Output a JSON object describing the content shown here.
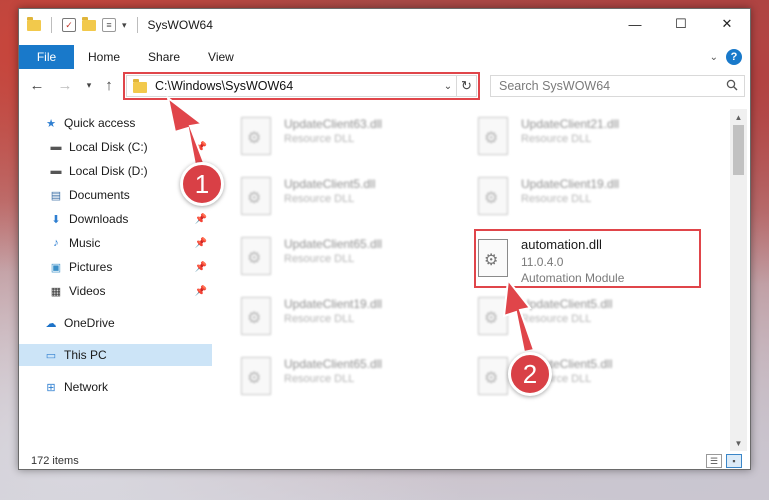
{
  "window": {
    "title": "SysWOW64",
    "controls": {
      "minimize": "—",
      "maximize": "☐",
      "close": "✕"
    }
  },
  "ribbon": {
    "tabs": [
      "File",
      "Home",
      "Share",
      "View"
    ],
    "help": "?"
  },
  "address": {
    "path": "C:\\Windows\\SysWOW64",
    "search_placeholder": "Search SysWOW64"
  },
  "nav": {
    "items": [
      {
        "label": "Quick access",
        "icon": "star-icon",
        "pinned": false
      },
      {
        "label": "Local Disk (C:)",
        "icon": "drive-icon",
        "pinned": true
      },
      {
        "label": "Local Disk (D:)",
        "icon": "drive-icon",
        "pinned": false
      },
      {
        "label": "Documents",
        "icon": "document-icon",
        "pinned": false
      },
      {
        "label": "Downloads",
        "icon": "download-icon",
        "pinned": true
      },
      {
        "label": "Music",
        "icon": "music-icon",
        "pinned": true
      },
      {
        "label": "Pictures",
        "icon": "pictures-icon",
        "pinned": true
      },
      {
        "label": "Videos",
        "icon": "video-icon",
        "pinned": true
      },
      {
        "label": "OneDrive",
        "icon": "cloud-icon",
        "pinned": false
      },
      {
        "label": "This PC",
        "icon": "pc-icon",
        "pinned": false,
        "selected": true
      },
      {
        "label": "Network",
        "icon": "network-icon",
        "pinned": false
      }
    ]
  },
  "files": [
    {
      "name": "UpdateClient63.dll",
      "type": "Resource DLL"
    },
    {
      "name": "UpdateClient21.dll",
      "type": "Resource DLL"
    },
    {
      "name": "UpdateClient5.dll",
      "type": "Resource DLL"
    },
    {
      "name": "UpdateClient19.dll",
      "type": "Resource DLL"
    },
    {
      "name": "UpdateClient65.dll",
      "type": "Resource DLL"
    },
    {
      "name": "UpdateClient19.dll",
      "type": "Resource DLL"
    },
    {
      "name": "UpdateClient5.dll",
      "type": "Resource DLL"
    },
    {
      "name": "UpdateClient65.dll",
      "type": "Resource DLL"
    },
    {
      "name": "UpdateClient5.dll",
      "type": "Resource DLL"
    }
  ],
  "target_file": {
    "name": "automation.dll",
    "version": "11.0.4.0",
    "type": "Automation Module"
  },
  "status": {
    "item_count": "172 items"
  },
  "callouts": {
    "one": "1",
    "two": "2"
  },
  "colors": {
    "accent": "#1979ca",
    "highlight": "#e0454a",
    "badge": "#d94046",
    "selected_nav": "#cce4f7"
  }
}
